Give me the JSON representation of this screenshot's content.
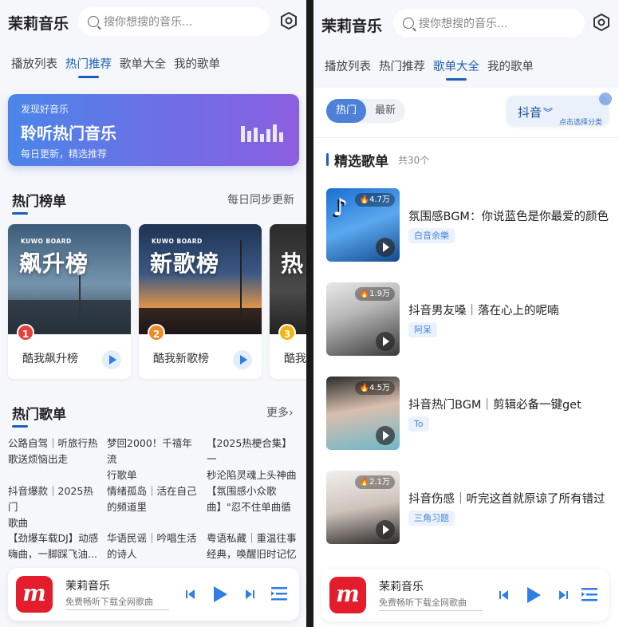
{
  "app": {
    "title": "茉莉音乐",
    "search_placeholder": "搜你想搜的音乐...",
    "tabs": [
      "播放列表",
      "热门推荐",
      "歌单大全",
      "我的歌单"
    ]
  },
  "left": {
    "active_tab": "热门推荐",
    "banner": {
      "sub": "发现好音乐",
      "title": "聆听热门音乐",
      "desc": "每日更新，精选推荐"
    },
    "charts_section": {
      "title": "热门榜单",
      "right": "每日同步更新"
    },
    "charts": [
      {
        "brand": "KUWO BOARD",
        "cover_title": "飙升榜",
        "rank": "1",
        "name": "酷我飙升榜",
        "rank_color": "#e8413c"
      },
      {
        "brand": "KUWO BOARD",
        "cover_title": "新歌榜",
        "rank": "2",
        "name": "酷我新歌榜",
        "rank_color": "#f08a24"
      },
      {
        "brand": "",
        "cover_title": "热",
        "rank": "3",
        "name": "酷我",
        "rank_color": "#f3b416"
      }
    ],
    "playlists_section": {
      "title": "热门歌单",
      "right": "更多›"
    },
    "playlists": [
      [
        "公路自驾｜听旅行热",
        "歌送烦恼出走"
      ],
      [
        "梦回2000！千禧年流",
        "行歌单"
      ],
      [
        "【2025热梗合集】一",
        "秒沦陷灵魂上头神曲"
      ],
      [
        "抖音爆款｜2025热门",
        "歌曲"
      ],
      [
        "情绪孤岛｜活在自己",
        "的频道里"
      ],
      [
        "【氛围感小众歌",
        "曲】\"忍不住单曲循"
      ],
      [
        "【劲爆车载DJ】动感",
        "嗨曲，一脚踩飞油..."
      ],
      [
        "华语民谣｜吟唱生活",
        "的诗人"
      ],
      [
        "粤语私藏｜重温往事",
        "经典，唤醒旧时记忆"
      ]
    ]
  },
  "right": {
    "active_tab": "歌单大全",
    "segments": [
      "热门",
      "最新"
    ],
    "category": {
      "value": "抖音",
      "hint": "点击选择分类"
    },
    "section": {
      "title": "精选歌单",
      "count": "共30个"
    },
    "items": [
      {
        "plays": "4.7万",
        "title": "氛围感BGM：你说蓝色是你最爱的颜色",
        "tag": "白音余樂"
      },
      {
        "plays": "1.9万",
        "title": "抖音男友嗓｜落在心上的呢喃",
        "tag": "阿呆"
      },
      {
        "plays": "4.5万",
        "title": "抖音热门BGM｜剪辑必备一键get",
        "tag": "To"
      },
      {
        "plays": "2.1万",
        "title": "抖音伤感｜听完这首就原谅了所有错过",
        "tag": "三角习题"
      }
    ]
  },
  "player": {
    "logo_text": "m",
    "name": "茉莉音乐",
    "desc": "免费畅听下载全网歌曲"
  },
  "colors": {
    "accent": "#1b5fb8",
    "brand_red": "#e31d2b",
    "play_blue": "#2f7ee6"
  }
}
